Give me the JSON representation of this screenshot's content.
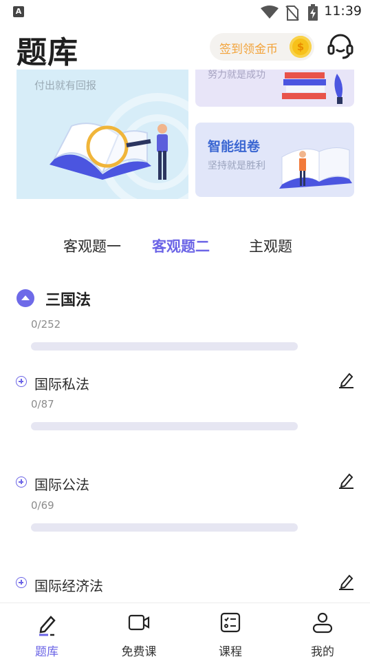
{
  "status_bar": {
    "time": "11:39",
    "notif_letter": "A"
  },
  "header": {
    "title": "题库",
    "checkin_label": "签到领金币",
    "coin_symbol": "$"
  },
  "banner": {
    "left_subtitle": "付出就有回报",
    "top_right_subtitle": "努力就是成功",
    "bottom_right_title": "智能组卷",
    "bottom_right_subtitle": "坚持就是胜利"
  },
  "tabs": [
    {
      "label": "客观题一",
      "active": false
    },
    {
      "label": "客观题二",
      "active": true
    },
    {
      "label": "主观题",
      "active": false
    }
  ],
  "section": {
    "title": "三国法",
    "count": "0/252",
    "progress": 0
  },
  "subjects": [
    {
      "title": "国际私法",
      "count": "0/87",
      "progress": 0
    },
    {
      "title": "国际公法",
      "count": "0/69",
      "progress": 0
    },
    {
      "title": "国际经济法",
      "count": "",
      "progress": 0
    }
  ],
  "bottom_nav": [
    {
      "label": "题库",
      "icon": "pencil-icon",
      "active": true
    },
    {
      "label": "免费课",
      "icon": "video-icon",
      "active": false
    },
    {
      "label": "课程",
      "icon": "checklist-icon",
      "active": false
    },
    {
      "label": "我的",
      "icon": "person-icon",
      "active": false
    }
  ],
  "colors": {
    "accent": "#6b64e6",
    "coin": "#f7c11a",
    "checkin_text": "#f2a33a",
    "banner_title": "#3b67d2"
  }
}
